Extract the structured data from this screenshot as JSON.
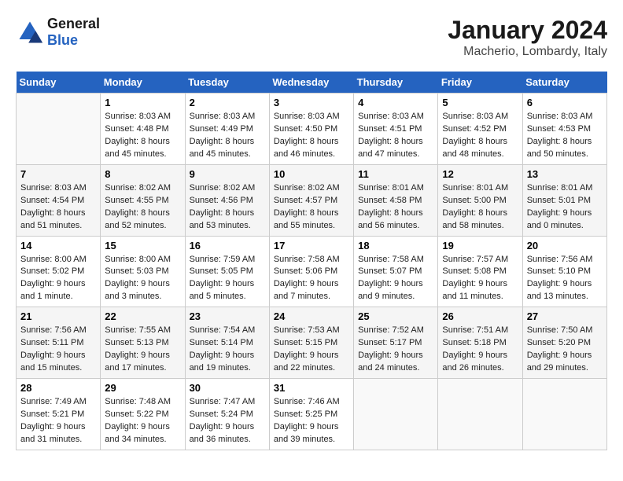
{
  "header": {
    "logo_general": "General",
    "logo_blue": "Blue",
    "title": "January 2024",
    "subtitle": "Macherio, Lombardy, Italy"
  },
  "calendar": {
    "days_of_week": [
      "Sunday",
      "Monday",
      "Tuesday",
      "Wednesday",
      "Thursday",
      "Friday",
      "Saturday"
    ],
    "weeks": [
      [
        {
          "day": "",
          "info": ""
        },
        {
          "day": "1",
          "info": "Sunrise: 8:03 AM\nSunset: 4:48 PM\nDaylight: 8 hours\nand 45 minutes."
        },
        {
          "day": "2",
          "info": "Sunrise: 8:03 AM\nSunset: 4:49 PM\nDaylight: 8 hours\nand 45 minutes."
        },
        {
          "day": "3",
          "info": "Sunrise: 8:03 AM\nSunset: 4:50 PM\nDaylight: 8 hours\nand 46 minutes."
        },
        {
          "day": "4",
          "info": "Sunrise: 8:03 AM\nSunset: 4:51 PM\nDaylight: 8 hours\nand 47 minutes."
        },
        {
          "day": "5",
          "info": "Sunrise: 8:03 AM\nSunset: 4:52 PM\nDaylight: 8 hours\nand 48 minutes."
        },
        {
          "day": "6",
          "info": "Sunrise: 8:03 AM\nSunset: 4:53 PM\nDaylight: 8 hours\nand 50 minutes."
        }
      ],
      [
        {
          "day": "7",
          "info": "Sunrise: 8:03 AM\nSunset: 4:54 PM\nDaylight: 8 hours\nand 51 minutes."
        },
        {
          "day": "8",
          "info": "Sunrise: 8:02 AM\nSunset: 4:55 PM\nDaylight: 8 hours\nand 52 minutes."
        },
        {
          "day": "9",
          "info": "Sunrise: 8:02 AM\nSunset: 4:56 PM\nDaylight: 8 hours\nand 53 minutes."
        },
        {
          "day": "10",
          "info": "Sunrise: 8:02 AM\nSunset: 4:57 PM\nDaylight: 8 hours\nand 55 minutes."
        },
        {
          "day": "11",
          "info": "Sunrise: 8:01 AM\nSunset: 4:58 PM\nDaylight: 8 hours\nand 56 minutes."
        },
        {
          "day": "12",
          "info": "Sunrise: 8:01 AM\nSunset: 5:00 PM\nDaylight: 8 hours\nand 58 minutes."
        },
        {
          "day": "13",
          "info": "Sunrise: 8:01 AM\nSunset: 5:01 PM\nDaylight: 9 hours\nand 0 minutes."
        }
      ],
      [
        {
          "day": "14",
          "info": "Sunrise: 8:00 AM\nSunset: 5:02 PM\nDaylight: 9 hours\nand 1 minute."
        },
        {
          "day": "15",
          "info": "Sunrise: 8:00 AM\nSunset: 5:03 PM\nDaylight: 9 hours\nand 3 minutes."
        },
        {
          "day": "16",
          "info": "Sunrise: 7:59 AM\nSunset: 5:05 PM\nDaylight: 9 hours\nand 5 minutes."
        },
        {
          "day": "17",
          "info": "Sunrise: 7:58 AM\nSunset: 5:06 PM\nDaylight: 9 hours\nand 7 minutes."
        },
        {
          "day": "18",
          "info": "Sunrise: 7:58 AM\nSunset: 5:07 PM\nDaylight: 9 hours\nand 9 minutes."
        },
        {
          "day": "19",
          "info": "Sunrise: 7:57 AM\nSunset: 5:08 PM\nDaylight: 9 hours\nand 11 minutes."
        },
        {
          "day": "20",
          "info": "Sunrise: 7:56 AM\nSunset: 5:10 PM\nDaylight: 9 hours\nand 13 minutes."
        }
      ],
      [
        {
          "day": "21",
          "info": "Sunrise: 7:56 AM\nSunset: 5:11 PM\nDaylight: 9 hours\nand 15 minutes."
        },
        {
          "day": "22",
          "info": "Sunrise: 7:55 AM\nSunset: 5:13 PM\nDaylight: 9 hours\nand 17 minutes."
        },
        {
          "day": "23",
          "info": "Sunrise: 7:54 AM\nSunset: 5:14 PM\nDaylight: 9 hours\nand 19 minutes."
        },
        {
          "day": "24",
          "info": "Sunrise: 7:53 AM\nSunset: 5:15 PM\nDaylight: 9 hours\nand 22 minutes."
        },
        {
          "day": "25",
          "info": "Sunrise: 7:52 AM\nSunset: 5:17 PM\nDaylight: 9 hours\nand 24 minutes."
        },
        {
          "day": "26",
          "info": "Sunrise: 7:51 AM\nSunset: 5:18 PM\nDaylight: 9 hours\nand 26 minutes."
        },
        {
          "day": "27",
          "info": "Sunrise: 7:50 AM\nSunset: 5:20 PM\nDaylight: 9 hours\nand 29 minutes."
        }
      ],
      [
        {
          "day": "28",
          "info": "Sunrise: 7:49 AM\nSunset: 5:21 PM\nDaylight: 9 hours\nand 31 minutes."
        },
        {
          "day": "29",
          "info": "Sunrise: 7:48 AM\nSunset: 5:22 PM\nDaylight: 9 hours\nand 34 minutes."
        },
        {
          "day": "30",
          "info": "Sunrise: 7:47 AM\nSunset: 5:24 PM\nDaylight: 9 hours\nand 36 minutes."
        },
        {
          "day": "31",
          "info": "Sunrise: 7:46 AM\nSunset: 5:25 PM\nDaylight: 9 hours\nand 39 minutes."
        },
        {
          "day": "",
          "info": ""
        },
        {
          "day": "",
          "info": ""
        },
        {
          "day": "",
          "info": ""
        }
      ]
    ]
  }
}
